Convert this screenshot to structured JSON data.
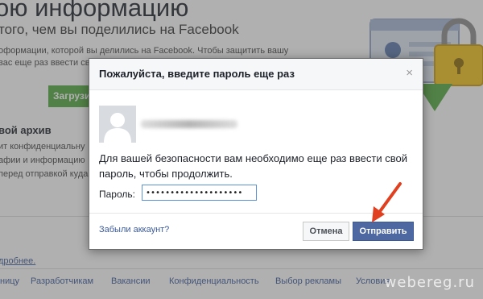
{
  "background": {
    "title": "ою информацию",
    "subtitle": "того, чем вы поделились на Facebook",
    "lines": [
      "оформации, которой вы делились на Facebook. Чтобы защитить вашу",
      "вас еще раз ввести св"
    ],
    "green_button": "Загрузи",
    "archive_heading": "вой архив",
    "archive_lines": [
      "ит конфиденциальну",
      "афии и информацию",
      "перед отправкой куда"
    ],
    "more_link": "дробнее.",
    "footer_links": [
      "ницу",
      "Разработчикам",
      "Вакансии",
      "Конфиденциальность",
      "Выбор рекламы",
      "Условия"
    ]
  },
  "dialog": {
    "title": "Пожалуйста, введите пароль еще раз",
    "close_glyph": "×",
    "message": "Для вашей безопасности вам необходимо еще раз ввести свой пароль, чтобы продолжить.",
    "password_label": "Пароль:",
    "password_value": "••••••••••••••••••••",
    "forgot_link": "Забыли аккаунт?",
    "cancel_button": "Отмена",
    "submit_button": "Отправить"
  },
  "watermark": "webereg.ru",
  "colors": {
    "fb_blue": "#3b5998",
    "submit_bg": "#4e69a2",
    "green": "#53a93f",
    "arrow_red": "#e0401f"
  },
  "icons": [
    "close-icon",
    "avatar-silhouette-icon",
    "lock-icon",
    "id-card-icon"
  ]
}
